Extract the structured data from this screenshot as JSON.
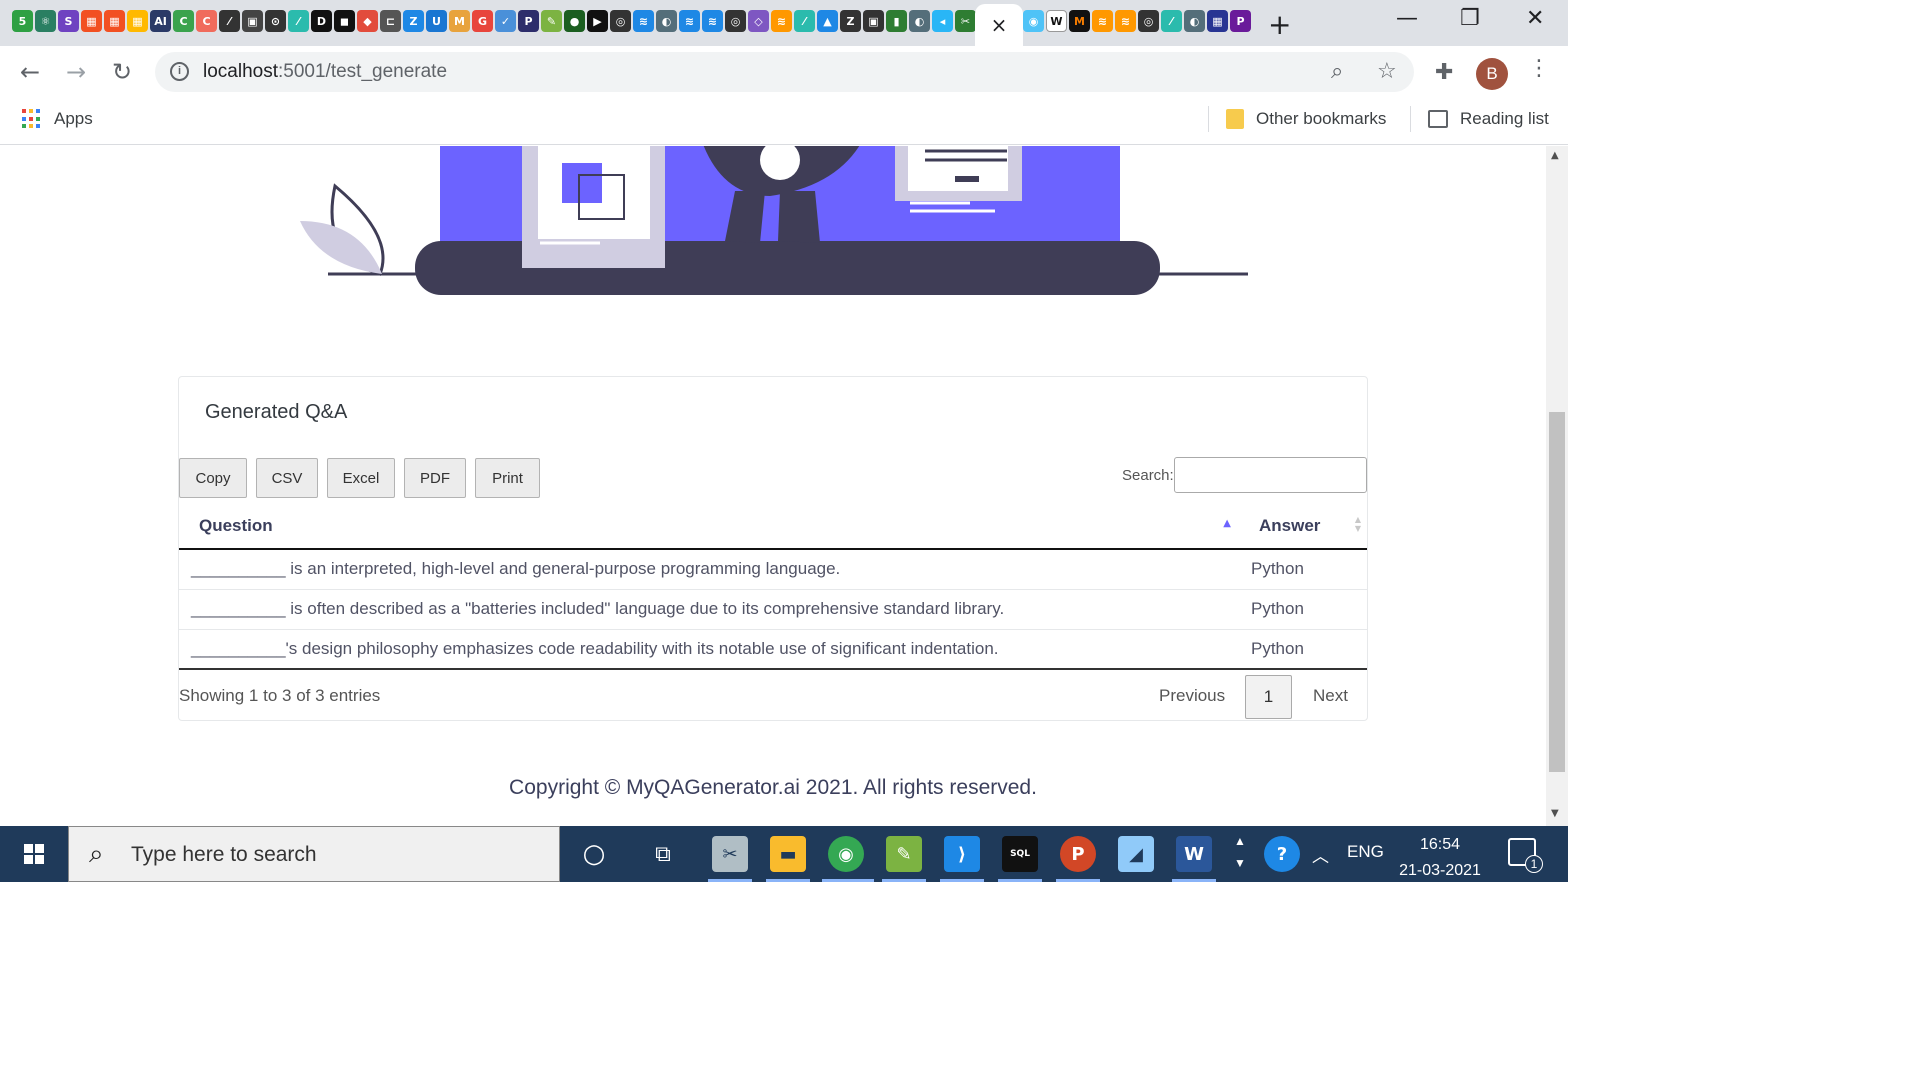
{
  "browser": {
    "active_tab_close": "×",
    "new_tab": "+",
    "window_controls": {
      "minimize": "—",
      "restore": "❐",
      "close": "✕"
    },
    "address": {
      "host": "localhost",
      "path": ":5001/test_generate"
    },
    "profile_initial": "B",
    "bookmarks": {
      "apps": "Apps",
      "other": "Other bookmarks",
      "reading_list": "Reading list"
    }
  },
  "page": {
    "card_title": "Generated Q&A",
    "buttons": {
      "copy": "Copy",
      "csv": "CSV",
      "excel": "Excel",
      "pdf": "PDF",
      "print": "Print"
    },
    "search_label": "Search:",
    "search_value": "",
    "table": {
      "headers": {
        "question": "Question",
        "answer": "Answer"
      },
      "rows": [
        {
          "question": "__________ is an interpreted, high-level and general-purpose programming language.",
          "answer": "Python"
        },
        {
          "question": "__________ is often described as a \"batteries included\" language due to its comprehensive standard library.",
          "answer": "Python"
        },
        {
          "question": "__________'s design philosophy emphasizes code readability with its notable use of significant indentation.",
          "answer": "Python"
        }
      ]
    },
    "info": "Showing 1 to 3 of 3 entries",
    "pagination": {
      "previous": "Previous",
      "current": "1",
      "next": "Next"
    },
    "copyright": "Copyright © MyQAGenerator.ai 2021. All rights reserved."
  },
  "taskbar": {
    "search_placeholder": "Type here to search",
    "language": "ENG",
    "time": "16:54",
    "date": "21-03-2021",
    "notifications": "1"
  },
  "colors": {
    "accent": "#6c63ff",
    "illustration_dark": "#3f3d56",
    "taskbar": "#1f3a5a"
  }
}
